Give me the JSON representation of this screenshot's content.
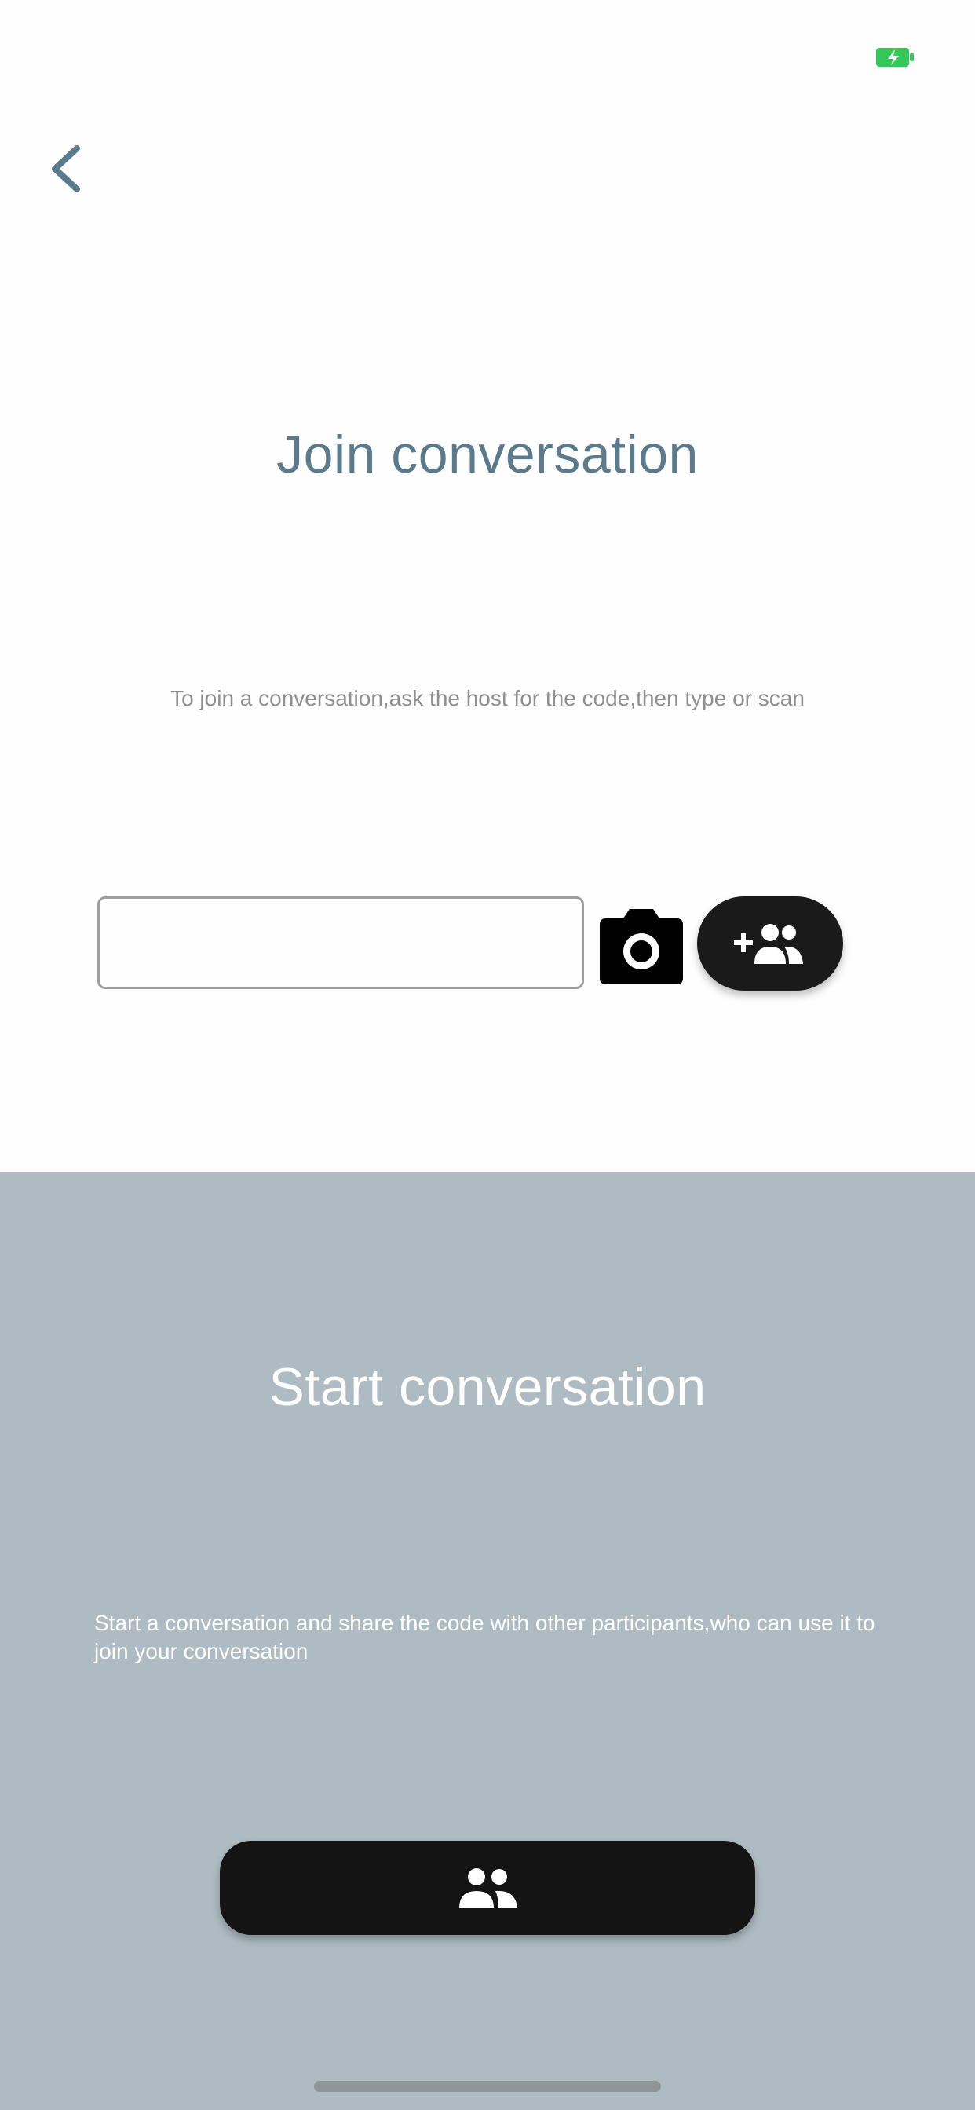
{
  "colors": {
    "title_join": "#5b7a8c",
    "bottom_background": "#aebbc2",
    "button_dark": "#141414",
    "battery_green": "#34c759"
  },
  "status_bar": {
    "battery_icon": "battery-charging-icon"
  },
  "nav": {
    "back_icon": "chevron-left-icon"
  },
  "join": {
    "title": "Join conversation",
    "description": "To join a conversation,ask the host for the code,then type or scan",
    "code_input": {
      "value": "",
      "placeholder": ""
    },
    "scan_icon": "camera-icon",
    "join_icon": "add-group-icon"
  },
  "start": {
    "title": "Start conversation",
    "description": "Start a conversation and share the code with other participants,who can use it to join your conversation",
    "start_icon": "group-icon"
  }
}
